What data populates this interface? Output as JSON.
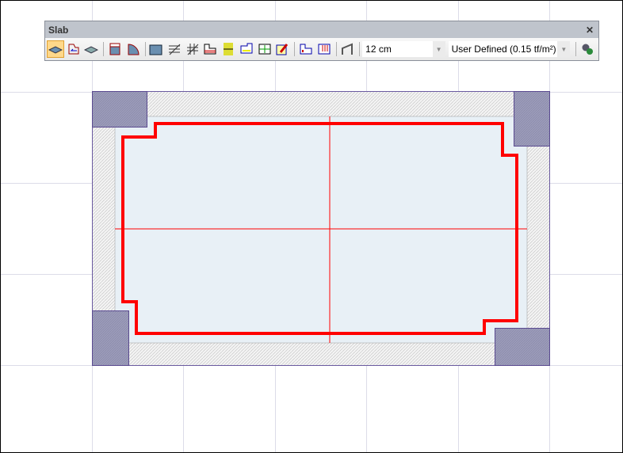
{
  "toolbar": {
    "title": "Slab",
    "close_icon": "close-icon",
    "buttons": [
      "slab-draw",
      "slab-polygon",
      "slab-rotate",
      "slab-rect",
      "slab-arc",
      "slab-label",
      "slab-hatch",
      "slab-grid",
      "slab-step",
      "slab-beam",
      "slab-split",
      "slab-dimension",
      "slab-edit",
      "slab-cantilever",
      "slab-load",
      "slab-slope"
    ],
    "thickness": "12 cm",
    "load": "User Defined  (0.15 tf/m²)",
    "settings_icon": "gears-icon"
  },
  "colors": {
    "slab_outline": "#ff0000",
    "slab_fill": "#e8f0f6",
    "column": "#9a9ab8",
    "grid": "#dcdce8"
  }
}
